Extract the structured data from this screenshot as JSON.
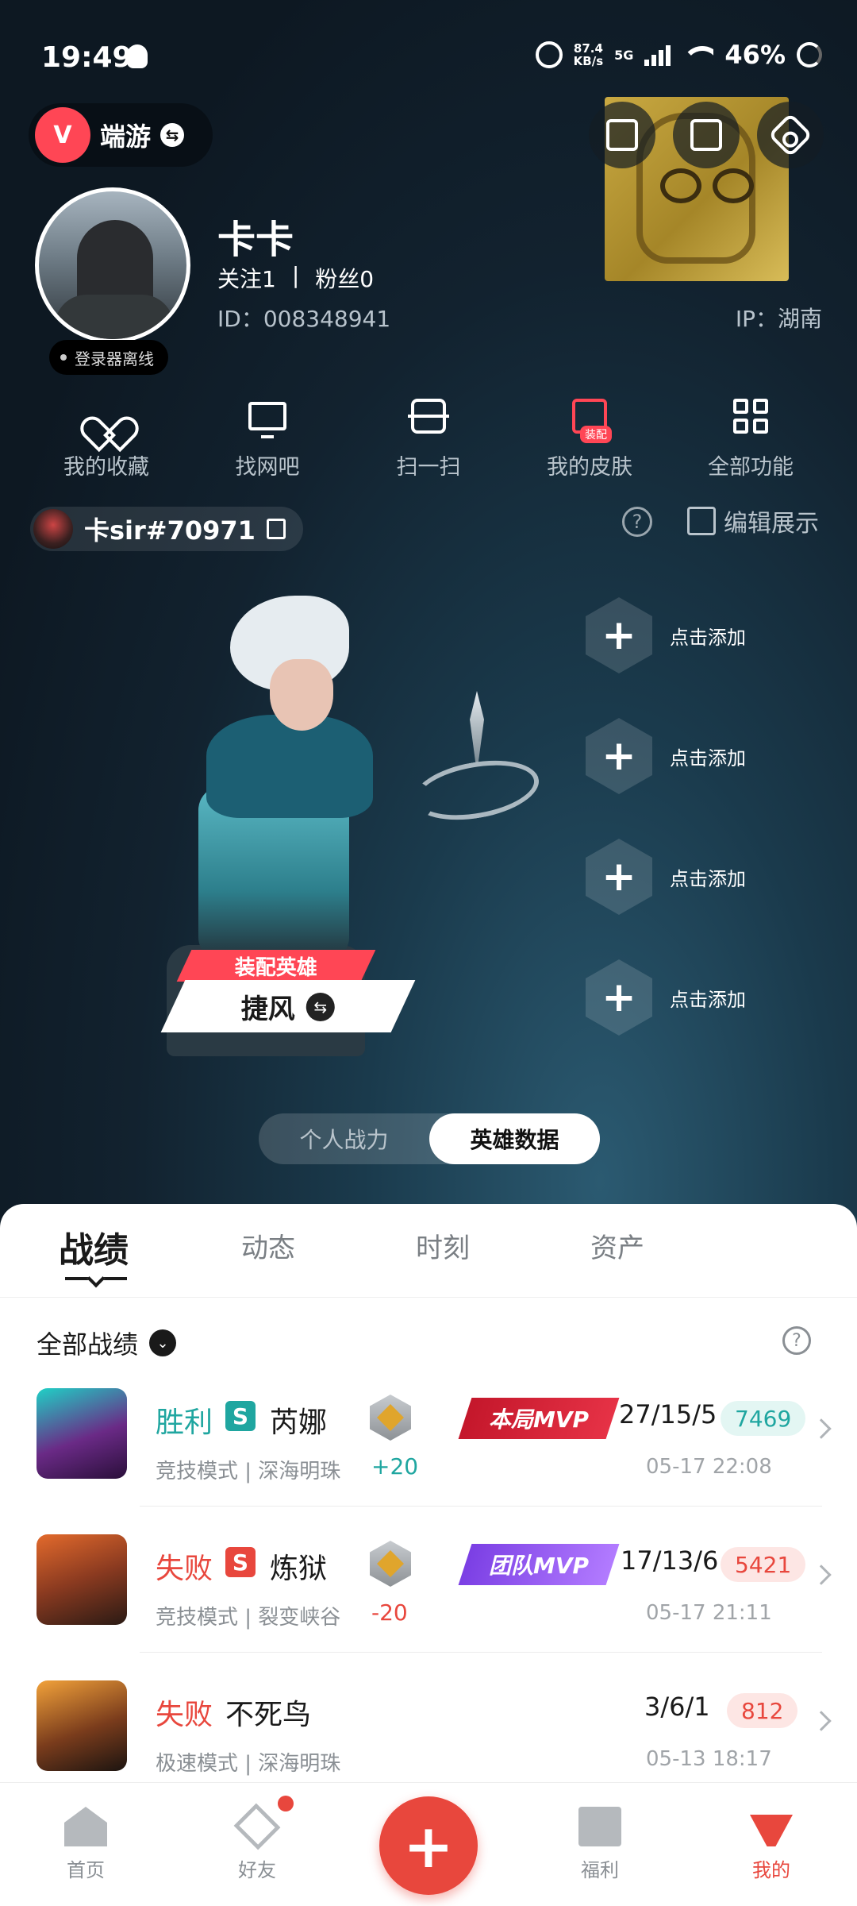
{
  "status_bar": {
    "time": "19:49",
    "net_speed_value": "87.4",
    "net_speed_unit": "KB/s",
    "network": "5G",
    "battery": "46%"
  },
  "header": {
    "game_name": "端游",
    "username": "卡卡",
    "follow_label": "关注",
    "follow_count": "1",
    "separator": "|",
    "fans_label": "粉丝",
    "fans_count": "0",
    "user_id": "ID：008348941",
    "ip": "IP：湖南",
    "login_status": "登录器离线",
    "icons": [
      "add-frame-icon",
      "share-icon",
      "settings-icon"
    ]
  },
  "quick_actions": [
    {
      "label": "我的收藏",
      "icon": "heart-icon"
    },
    {
      "label": "找网吧",
      "icon": "monitor-icon"
    },
    {
      "label": "扫一扫",
      "icon": "scan-icon"
    },
    {
      "label": "我的皮肤",
      "icon": "skin-icon",
      "badge": "装配"
    },
    {
      "label": "全部功能",
      "icon": "grid-icon"
    }
  ],
  "riot": {
    "id": "卡sir#70971",
    "edit_label": "编辑展示",
    "help": "?"
  },
  "hero": {
    "equip_label": "装配英雄",
    "name": "捷风",
    "slots": [
      {
        "label": "点击添加"
      },
      {
        "label": "点击添加"
      },
      {
        "label": "点击添加"
      },
      {
        "label": "点击添加"
      }
    ]
  },
  "toggle": {
    "options": [
      "个人战力",
      "英雄数据"
    ],
    "active": 1
  },
  "tabs": [
    "战绩",
    "动态",
    "时刻",
    "资产"
  ],
  "active_tab": 0,
  "filter": {
    "label": "全部战绩",
    "help": "?"
  },
  "matches": [
    {
      "result": "胜利",
      "rank_letter": "S",
      "agent": "芮娜",
      "mode_map": "竞技模式 | 深海明珠",
      "rr_delta": "+20",
      "mvp": "本局MVP",
      "kda": "27/15/5",
      "score": "7469",
      "datetime": "05-17 22:08",
      "colors": {
        "result": "#1fa6a0",
        "badge": "#1fa6a0"
      }
    },
    {
      "result": "失败",
      "rank_letter": "S",
      "agent": "炼狱",
      "mode_map": "竞技模式 | 裂变峡谷",
      "rr_delta": "-20",
      "mvp": "团队MVP",
      "kda": "17/13/6",
      "score": "5421",
      "datetime": "05-17 21:11",
      "colors": {
        "result": "#e8473d",
        "badge": "#e8473d"
      }
    },
    {
      "result": "失败",
      "agent": "不死鸟",
      "mode_map": "极速模式 | 深海明珠",
      "kda": "3/6/1",
      "score": "812",
      "datetime": "05-13 18:17",
      "colors": {
        "result": "#e8473d"
      }
    }
  ],
  "bottom_nav": [
    {
      "label": "首页",
      "icon": "home-icon"
    },
    {
      "label": "好友",
      "icon": "friends-icon"
    },
    {
      "label": "",
      "icon": "plus-icon"
    },
    {
      "label": "福利",
      "icon": "gift-icon"
    },
    {
      "label": "我的",
      "icon": "profile-icon"
    }
  ],
  "fab_symbol": "+",
  "colors": {
    "accent": "#ff4655",
    "win": "#1fa6a0",
    "loss": "#e8473d"
  }
}
